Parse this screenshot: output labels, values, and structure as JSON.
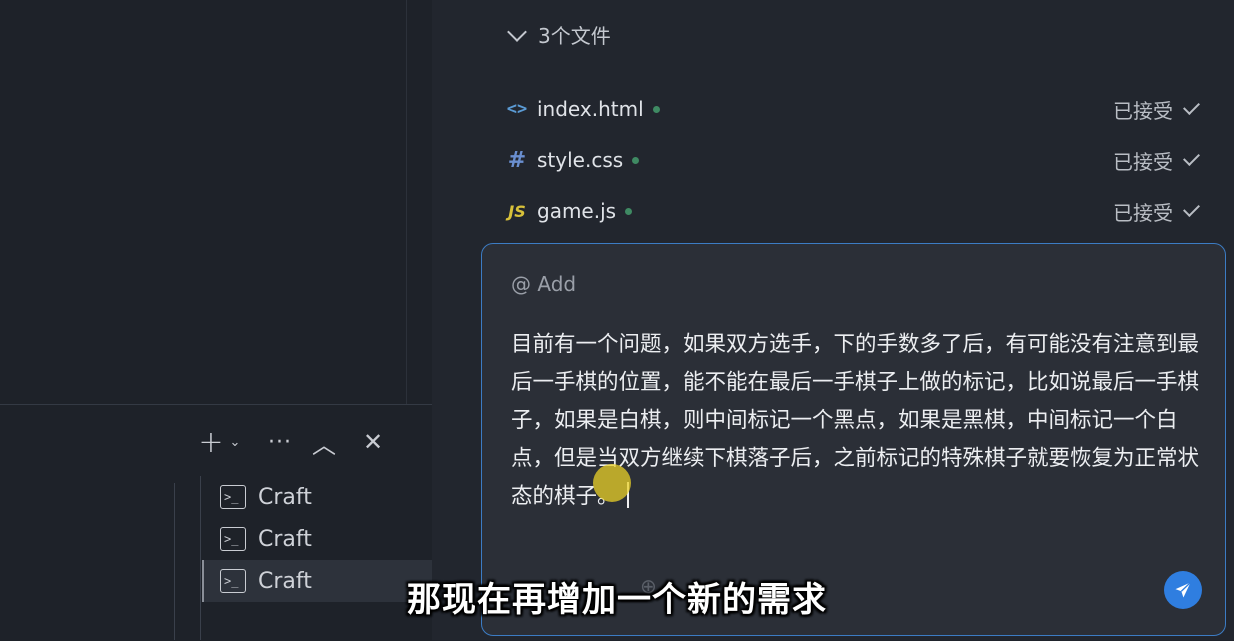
{
  "files_panel": {
    "header": "3个文件",
    "files": [
      {
        "name": "index.html",
        "icon": "html-code-icon",
        "icon_glyph": "<>",
        "status": "已接受"
      },
      {
        "name": "style.css",
        "icon": "css-hash-icon",
        "icon_glyph": "#",
        "status": "已接受"
      },
      {
        "name": "game.js",
        "icon": "js-file-icon",
        "icon_glyph": "JS",
        "status": "已接受"
      }
    ]
  },
  "chat": {
    "add_context": "@ Add",
    "message": "目前有一个问题，如果双方选手，下的手数多了后，有可能没有注意到最后一手棋的位置，能不能在最后一手棋子上做的标记，比如说最后一手棋子，如果是白棋，则中间标记一个黑点，如果是黑棋，中间标记一个白点，但是当双方继续下棋落子后，之前标记的特殊棋子就要恢复为正常状态的棋子。"
  },
  "terminal": {
    "toolbar": {
      "plus": "+",
      "chevron": "⌄",
      "more": "···",
      "up": "︿",
      "close": "✕"
    },
    "items": [
      {
        "label": "Craft"
      },
      {
        "label": "Craft"
      },
      {
        "label": "Craft"
      }
    ]
  },
  "subtitle": "那现在再增加一个新的需求",
  "colors": {
    "accent": "#3c7cc4",
    "send_button": "#2f7ee0",
    "accepted_dot": "#3f8a63"
  }
}
